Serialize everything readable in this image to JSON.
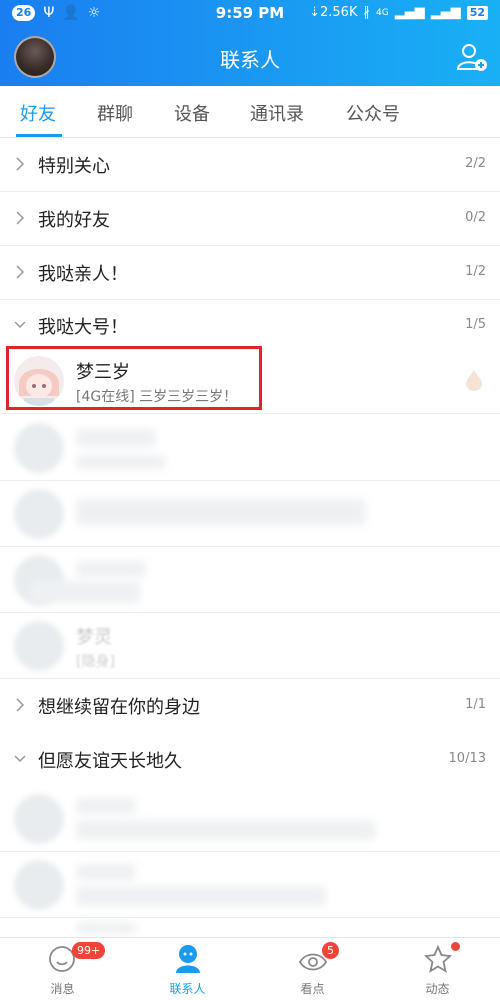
{
  "statusbar": {
    "notif_count": "26",
    "time": "9:59 PM",
    "net_speed": "2.56K",
    "net_type": "4G",
    "battery": "52"
  },
  "header": {
    "title": "联系人"
  },
  "tabs": [
    "好友",
    "群聊",
    "设备",
    "通讯录",
    "公众号"
  ],
  "groups": [
    {
      "name": "特别关心",
      "count": "2/2"
    },
    {
      "name": "我的好友",
      "count": "0/2"
    },
    {
      "name": "我哒亲人！",
      "count": "1/2"
    },
    {
      "name": "我哒大号！",
      "count": "1/5"
    },
    {
      "name": "想继续留在你的身边",
      "count": "1/1"
    },
    {
      "name": "但愿友谊天长地久",
      "count": "10/13"
    }
  ],
  "friend_highlight": {
    "name": "梦三岁",
    "status": "[4G在线] 三岁三岁三岁！"
  },
  "blurred_friend": {
    "name": "梦灵",
    "status": "[隐身]"
  },
  "bottom_nav": [
    {
      "label": "消息",
      "badge": "99+"
    },
    {
      "label": "联系人",
      "badge": ""
    },
    {
      "label": "看点",
      "badge": "5"
    },
    {
      "label": "动态",
      "badge": ""
    }
  ],
  "colors": {
    "accent": "#1a9bf0",
    "header_from": "#1a7ef0",
    "header_to": "#19b0f5",
    "highlight_border": "#e0242b",
    "badge": "#f04438"
  }
}
